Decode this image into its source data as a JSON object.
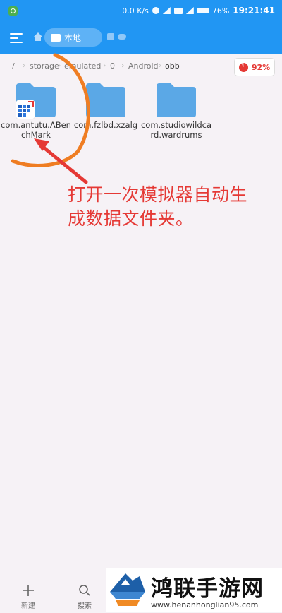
{
  "status_bar": {
    "speed": "0.0 K/s",
    "battery": "76%",
    "time": "19:21:41"
  },
  "toolbar": {
    "tab_label": "本地"
  },
  "breadcrumb": {
    "root": "/",
    "items": [
      "storage",
      "emulated",
      "0",
      "Android",
      "obb"
    ]
  },
  "storage": {
    "percent": "92%"
  },
  "folders": [
    {
      "name": "com.antutu.ABenchMark"
    },
    {
      "name": "com.fzlbd.xzalg"
    },
    {
      "name": "com.studiowildcard.wardrums"
    }
  ],
  "annotation": {
    "text": "打开一次模拟器自动生成数据文件夹。"
  },
  "bottom_bar": {
    "new_label": "新建",
    "search_label": "搜索"
  },
  "watermark": {
    "title": "鸿联手游网",
    "url": "www.henanhonglian95.com"
  },
  "colors": {
    "primary": "#2196f3",
    "folder": "#5ba8e6",
    "annotation": "#e53935",
    "arc": "#ef7d22"
  }
}
